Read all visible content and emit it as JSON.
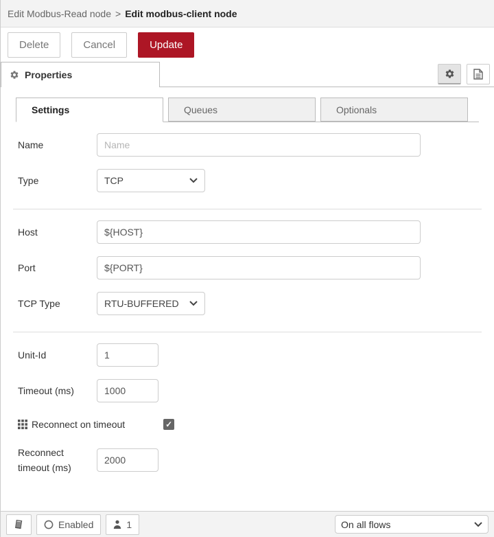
{
  "header": {
    "breadcrumb_prefix": "Edit Modbus-Read node",
    "separator": ">",
    "title": "Edit modbus-client node"
  },
  "toolbar": {
    "delete_label": "Delete",
    "cancel_label": "Cancel",
    "update_label": "Update"
  },
  "properties_tab": {
    "label": "Properties"
  },
  "tabs": [
    {
      "label": "Settings",
      "active": true
    },
    {
      "label": "Queues",
      "active": false
    },
    {
      "label": "Optionals",
      "active": false
    }
  ],
  "form": {
    "name": {
      "label": "Name",
      "placeholder": "Name",
      "value": ""
    },
    "type": {
      "label": "Type",
      "value": "TCP"
    },
    "host": {
      "label": "Host",
      "value": "${HOST}"
    },
    "port": {
      "label": "Port",
      "value": "${PORT}"
    },
    "tcp_type": {
      "label": "TCP Type",
      "value": "RTU-BUFFERED"
    },
    "unit_id": {
      "label": "Unit-Id",
      "value": "1"
    },
    "timeout": {
      "label": "Timeout (ms)",
      "value": "1000"
    },
    "reconnect_on_timeout": {
      "label": "Reconnect on timeout",
      "checked": "true"
    },
    "reconnect_timeout": {
      "label_line1": "Reconnect",
      "label_line2": "timeout (ms)",
      "value": "2000"
    }
  },
  "footer": {
    "enabled_label": "Enabled",
    "instance_count": "1",
    "deploy_scope": "On all flows"
  },
  "icons": {
    "properties": "gear-icon",
    "config": "gear-icon",
    "docs": "file-text-icon",
    "library": "book-icon",
    "status": "circle-outline-icon",
    "instances": "user-icon",
    "reconnect": "grid-icon",
    "dropdown": "chevron-down-icon"
  },
  "colors": {
    "accent_red": "#AD1625",
    "header_bg": "#f3f3f3",
    "footer_bg": "#f3f3f3",
    "border": "#ccc",
    "tab_inactive_bg": "#f0f0f0"
  }
}
